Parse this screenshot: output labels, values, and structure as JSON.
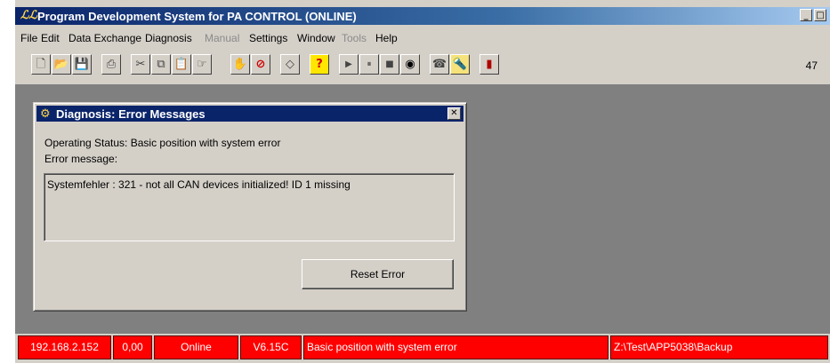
{
  "window": {
    "title": "Program Development System for PA CONTROL (ONLINE)",
    "icon": "app-logo-icon",
    "controls": [
      "_",
      "□"
    ]
  },
  "menu": [
    {
      "label": "File",
      "enabled": true
    },
    {
      "label": "Edit",
      "enabled": true
    },
    {
      "label": "Data Exchange",
      "enabled": true
    },
    {
      "label": "Diagnosis",
      "enabled": true
    },
    {
      "label": "Manual",
      "enabled": false
    },
    {
      "label": "Settings",
      "enabled": true
    },
    {
      "label": "Window",
      "enabled": true
    },
    {
      "label": "Tools",
      "enabled": false
    },
    {
      "label": "Help",
      "enabled": true
    }
  ],
  "toolbar": {
    "buttons": [
      {
        "icon": "new-file-icon",
        "glyph": "🗋"
      },
      {
        "icon": "open-folder-icon",
        "glyph": "📂"
      },
      {
        "icon": "save-icon",
        "glyph": "💾"
      },
      {
        "icon": "print-icon",
        "glyph": "⎙"
      },
      {
        "icon": "cut-icon",
        "glyph": "✂"
      },
      {
        "icon": "copy-icon",
        "glyph": "⧉"
      },
      {
        "icon": "paste-icon",
        "glyph": "📋"
      },
      {
        "icon": "pointer-hand-icon",
        "glyph": "☞"
      },
      {
        "icon": "hand-icon",
        "glyph": "✋"
      },
      {
        "icon": "stop-sign-icon",
        "glyph": "⊘"
      },
      {
        "icon": "eraser-icon",
        "glyph": "◇"
      },
      {
        "icon": "help-icon",
        "glyph": "?"
      },
      {
        "icon": "play-icon",
        "glyph": "▶"
      },
      {
        "icon": "pause-icon",
        "glyph": "⏸"
      },
      {
        "icon": "stop-icon",
        "glyph": "■"
      },
      {
        "icon": "record-icon",
        "glyph": "◉"
      },
      {
        "icon": "phone-icon",
        "glyph": "☎"
      },
      {
        "icon": "flashlight-icon",
        "glyph": "🔦"
      },
      {
        "icon": "exit-door-icon",
        "glyph": "▮"
      }
    ],
    "counter": "47"
  },
  "dialog": {
    "title": "Diagnosis: Error Messages",
    "close": "✕",
    "status_text": "Operating Status:  Basic position with system error",
    "error_label": "Error message:",
    "error_text": "Systemfehler : 321  - not all CAN devices initialized!  ID 1 missing",
    "reset_button": "Reset Error"
  },
  "statusbar": {
    "ip": "192.168.2.152",
    "value": "0,00",
    "mode": "Online",
    "version": "V6.15C",
    "state": "Basic position with system error",
    "path": "Z:\\Test\\APP5038\\Backup"
  },
  "colors": {
    "status_red": "#ff0000",
    "title_blue": "#0a246a",
    "workspace_gray": "#808080"
  }
}
